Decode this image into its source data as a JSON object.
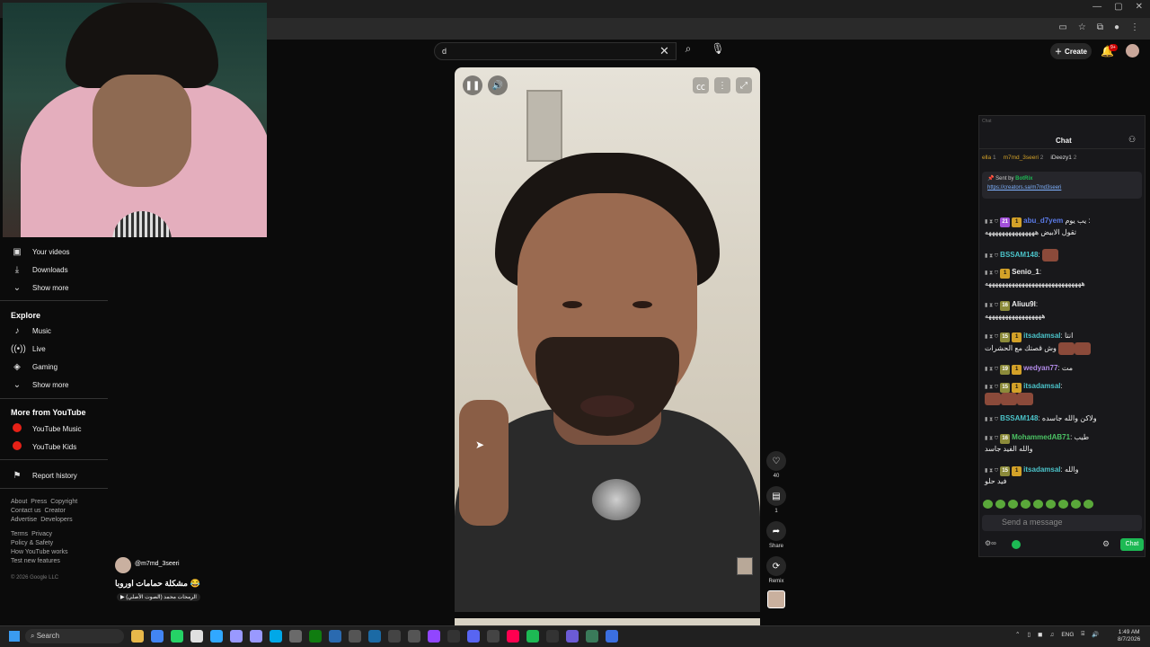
{
  "window": {
    "controls": [
      "—",
      "▢",
      "✕"
    ]
  },
  "search": {
    "value": "d"
  },
  "header": {
    "create_label": "Create",
    "notif_badge": "9+"
  },
  "sidebar": {
    "you_items": [
      {
        "label": "Your videos",
        "icon": "video-icon"
      },
      {
        "label": "Downloads",
        "icon": "download-icon"
      },
      {
        "label": "Show more",
        "icon": "chevron-down-icon"
      }
    ],
    "explore_heading": "Explore",
    "explore_items": [
      {
        "label": "Music",
        "icon": "music-icon"
      },
      {
        "label": "Live",
        "icon": "live-icon"
      },
      {
        "label": "Gaming",
        "icon": "gaming-icon"
      },
      {
        "label": "Show more",
        "icon": "chevron-down-icon"
      }
    ],
    "more_heading": "More from YouTube",
    "more_items": [
      {
        "label": "YouTube Music",
        "icon": "youtube-music-icon"
      },
      {
        "label": "YouTube Kids",
        "icon": "youtube-kids-icon"
      }
    ],
    "report_label": "Report history",
    "footer1": [
      "About",
      "Press",
      "Copyright",
      "Contact us",
      "Creator",
      "Advertise",
      "Developers"
    ],
    "footer2": [
      "Terms",
      "Privacy",
      "Policy & Safety",
      "How YouTube works",
      "Test new features"
    ],
    "copyright": "© 2026 Google LLC"
  },
  "short": {
    "channel": "@m7md_3seeri",
    "title": "مشكلة حمامات اوروبا 😂",
    "music": "الرمحات محمد (الصوت الأصلي)",
    "like_count": "40",
    "comment_count": "1",
    "share_label": "Share",
    "remix_label": "Remix"
  },
  "chat": {
    "mini_label": "Chat",
    "title": "Chat",
    "top_users": [
      {
        "name": "ella",
        "count": "1"
      },
      {
        "name": "m7md_3seeri",
        "count": "2"
      },
      {
        "name": "iDeezy1",
        "count": "2"
      }
    ],
    "pinned": {
      "sent_by": "Sent by",
      "bot": "BotRix",
      "link": "https://creators.sa/m7md3seeri"
    },
    "messages": [
      {
        "user": "abu_d7yem",
        "color": "#5b7be8",
        "badges": [
          "21",
          "1"
        ],
        "text": "يب يوم :",
        "text2": "تقول الابيض هههههههههههههههه"
      },
      {
        "user": "BSSAM148",
        "color": "#4bc3c9",
        "badges": [],
        "text": ""
      },
      {
        "user": "Senio_1",
        "color": "#dddddd",
        "badges": [
          "1"
        ],
        "text": "",
        "text2": "هههههههههههههههههههههههههههههه"
      },
      {
        "user": "Aliuu9l",
        "color": "#dddddd",
        "badges": [
          "16"
        ],
        "text": "",
        "text2": "هههههههههههههههههه"
      },
      {
        "user": "itsadamsal",
        "color": "#4bc3c9",
        "badges": [
          "15",
          "1"
        ],
        "text": "انتا",
        "text2": "وش قصتك مع الحشرات"
      },
      {
        "user": "wedyan77",
        "color": "#b28be8",
        "badges": [
          "19",
          "1"
        ],
        "text": "مت"
      },
      {
        "user": "itsadamsal",
        "color": "#4bc3c9",
        "badges": [
          "15",
          "1"
        ],
        "text": ""
      },
      {
        "user": "BSSAM148",
        "color": "#4bc3c9",
        "badges": [],
        "text": "ولاكن والله جاسده"
      },
      {
        "user": "MohammedAB71",
        "color": "#4bc364",
        "badges": [
          "16"
        ],
        "text": "طيب",
        "text2": "والله الفيد جاسد"
      },
      {
        "user": "itsadamsal",
        "color": "#4bc3c9",
        "badges": [
          "15",
          "1"
        ],
        "text": "والله",
        "text2": "فيد حلو"
      }
    ],
    "input_placeholder": "Send a message",
    "send_label": "Chat"
  },
  "taskbar": {
    "search_label": "Search",
    "lang": "ENG",
    "time": "1:49 AM",
    "date": "8/7/2026"
  }
}
